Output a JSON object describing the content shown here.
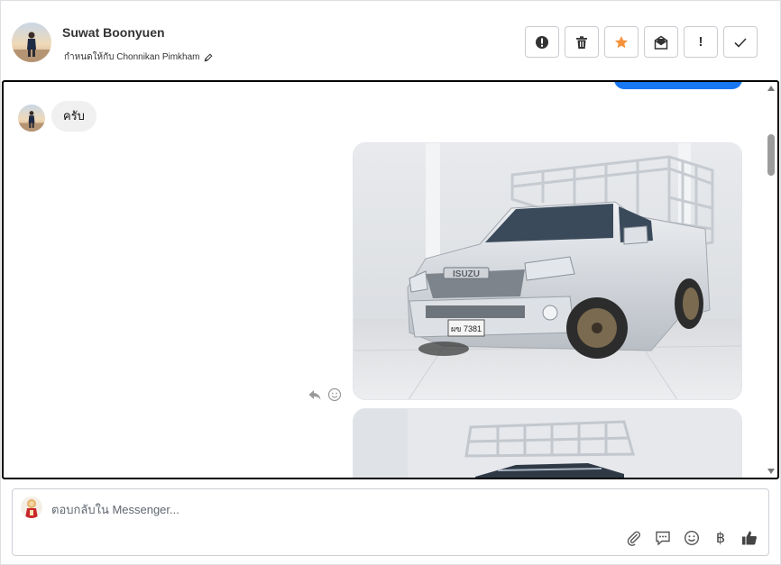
{
  "header": {
    "contact_name": "Suwat Boonyuen",
    "assigned_to": "กำหนดให้กับ Chonnikan Pimkham",
    "actions": [
      {
        "name": "spam-button",
        "icon": "alert-circle-icon"
      },
      {
        "name": "delete-button",
        "icon": "trash-icon"
      },
      {
        "name": "star-button",
        "icon": "star-icon"
      },
      {
        "name": "mark-unread-button",
        "icon": "mail-envelope-icon"
      },
      {
        "name": "follow-up-button",
        "icon": "exclamation-icon"
      },
      {
        "name": "mark-done-button",
        "icon": "check-icon"
      }
    ]
  },
  "conversation": {
    "incoming_message": "ครับ"
  },
  "composer": {
    "placeholder": "ตอบกลับใน Messenger...",
    "currency_symbol": "฿"
  },
  "colors": {
    "accent": "#1877f2",
    "star": "#f7923b",
    "border_active": "#000000"
  }
}
